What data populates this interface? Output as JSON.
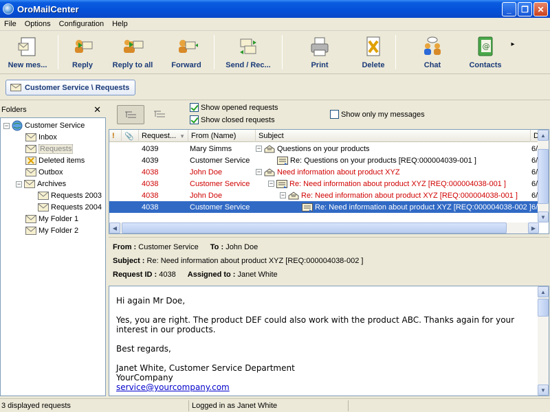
{
  "window": {
    "title": "OroMailCenter",
    "minimize": "_",
    "maximize": "❐",
    "close": "✕"
  },
  "menu": [
    "File",
    "Options",
    "Configuration",
    "Help"
  ],
  "toolbar": {
    "new": "New mes...",
    "reply": "Reply",
    "reply_all": "Reply to all",
    "forward": "Forward",
    "send_receive": "Send / Rec...",
    "print": "Print",
    "delete": "Delete",
    "chat": "Chat",
    "contacts": "Contacts",
    "more": "▸"
  },
  "breadcrumb": "Customer Service \\ Requests",
  "folders": {
    "title": "Folders",
    "close": "✕",
    "items": [
      "Customer Service",
      "Inbox",
      "Requests",
      "Deleted items",
      "Outbox",
      "Archives",
      "Requests 2003",
      "Requests 2004",
      "My Folder 1",
      "My Folder 2"
    ]
  },
  "filters": {
    "show_opened": "Show opened requests",
    "show_closed": "Show closed requests",
    "show_mine": "Show only my messages"
  },
  "grid": {
    "columns": [
      "!",
      "",
      "Request...",
      "From (Name)",
      "Subject",
      "D"
    ],
    "rows": [
      {
        "id": "4039",
        "from": "Mary Simms",
        "subject": "Questions on your products",
        "d": "6/"
      },
      {
        "id": "4039",
        "from": "Customer Service",
        "subject": "Re: Questions on your products [REQ:000004039-001 ]",
        "d": "6/"
      },
      {
        "id": "4038",
        "from": "John Doe",
        "subject": "Need information about product XYZ",
        "d": "6/"
      },
      {
        "id": "4038",
        "from": "Customer Service",
        "subject": "Re: Need information about product XYZ [REQ:000004038-001 ]",
        "d": "6/"
      },
      {
        "id": "4038",
        "from": "John Doe",
        "subject": "Re: Need information about product XYZ [REQ:000004038-001 ]",
        "d": "6/"
      },
      {
        "id": "4038",
        "from": "Customer Service",
        "subject": "Re: Need information about product XYZ [REQ:000004038-002 ]",
        "d": "6/"
      }
    ]
  },
  "details": {
    "from_label": "From :",
    "from": "Customer Service",
    "to_label": "To :",
    "to": "John Doe",
    "subject_label": "Subject :",
    "subject": "Re: Need information about product XYZ [REQ:000004038-002 ]",
    "reqid_label": "Request ID :",
    "reqid": "4038",
    "assigned_label": "Assigned to :",
    "assigned": "Janet White"
  },
  "body": {
    "greeting": "Hi again Mr Doe,",
    "para": "Yes, you are right. The product DEF could also work with the product ABC. Thanks again for your interest in our products.",
    "regards": "Best regards,",
    "sig1": "Janet White, Customer Service Department",
    "sig2": "YourCompany",
    "email": "service@yourcompany.com"
  },
  "status": {
    "count": "3 displayed requests",
    "user": "Logged in as Janet White"
  },
  "colors": {
    "accent": "#316ac5",
    "red": "#d00000",
    "label": "#1a3a78"
  }
}
